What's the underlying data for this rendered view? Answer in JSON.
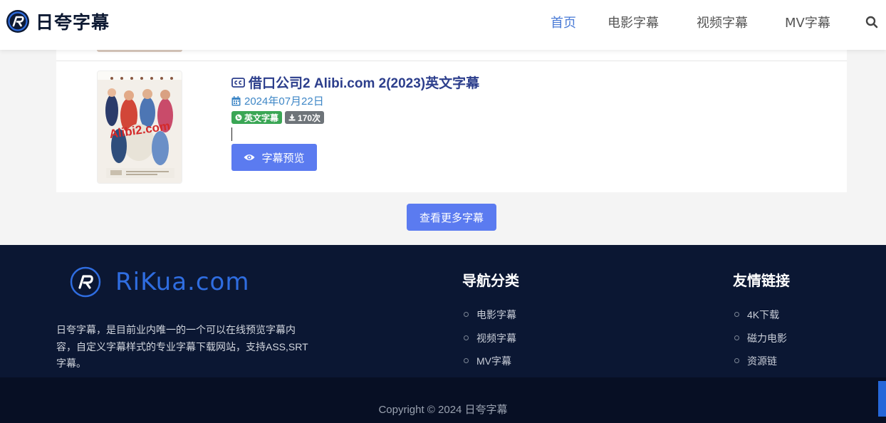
{
  "brand": {
    "name": "日夸字幕",
    "footer_logo_text": "RiKua.com"
  },
  "nav": {
    "items": [
      "首页",
      "电影字幕",
      "视频字幕",
      "MV字幕"
    ],
    "active": "首页",
    "search_icon": "search-icon"
  },
  "post": {
    "title": "借口公司2 Alibi.com 2(2023)英文字幕",
    "date": "2024年07月22日",
    "language_badge": "英文字幕",
    "download_badge": "170次",
    "preview_label": "字幕预览",
    "poster_text": "Alibi2.com"
  },
  "more_button": "查看更多字幕",
  "footer": {
    "description": "日夸字幕，是目前业内唯一的一个可以在线预览字幕内容，自定义字幕样式的专业字幕下载网站，支持ASS,SRT字幕。",
    "nav_title": "导航分类",
    "nav_links": [
      "电影字幕",
      "视频字幕",
      "MV字幕"
    ],
    "friends_title": "友情链接",
    "friend_links": [
      "4K下载",
      "磁力电影",
      "资源链"
    ],
    "copyright": "Copyright © 2024 日夸字幕"
  },
  "colors": {
    "accent": "#5b7bf0",
    "nav_active": "#4a7bd6",
    "footer_bg": "#0b1733",
    "badge_green": "#3aa655",
    "badge_gray": "#6e7479"
  }
}
